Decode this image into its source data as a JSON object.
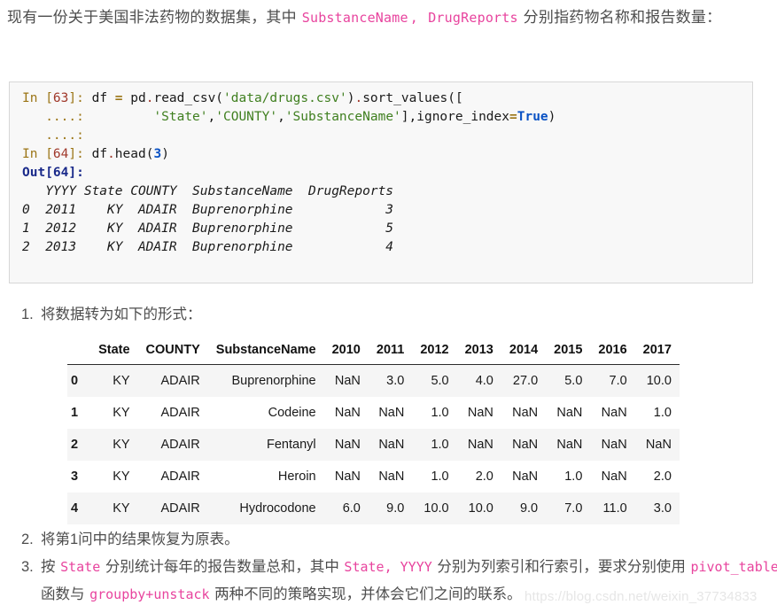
{
  "intro": {
    "part1": "现有一份关于美国非法药物的数据集，其中 ",
    "code1": "SubstanceName",
    "sep1": ", ",
    "code2": "DrugReports",
    "part2": " 分别指药物名称和报告数量："
  },
  "code_block": {
    "line1_prompt": "In [",
    "line1_num": "63",
    "line1_promptend": "]: ",
    "line1_a": "df ",
    "line1_eq": "=",
    "line1_b": " pd",
    "line1_dot1": ".",
    "line1_c": "read_csv(",
    "line1_str1": "'data/drugs.csv'",
    "line1_d": ")",
    "line1_dot2": ".",
    "line1_e": "sort_values([",
    "line2_dots": "   ....:         ",
    "line2_str1": "'State'",
    "line2_c1": ",",
    "line2_str2": "'COUNTY'",
    "line2_c2": ",",
    "line2_str3": "'SubstanceName'",
    "line2_rest": "],ignore_index",
    "line2_eq": "=",
    "line2_kw": "True",
    "line2_end": ")",
    "line3_dots": "   ....: ",
    "line4_prompt": "In [",
    "line4_num": "64",
    "line4_promptend": "]: ",
    "line4_a": "df",
    "line4_dot": ".",
    "line4_b": "head(",
    "line4_arg": "3",
    "line4_c": ")",
    "out_label": "Out[64]:",
    "out_header": "   YYYY State COUNTY  SubstanceName  DrugReports",
    "out_row0": "0  2011    KY  ADAIR  Buprenorphine            3",
    "out_row1": "1  2012    KY  ADAIR  Buprenorphine            5",
    "out_row2": "2  2013    KY  ADAIR  Buprenorphine            4"
  },
  "list": {
    "item1_marker": "1.",
    "item1_text": "将数据转为如下的形式：",
    "item2_marker": "2.",
    "item2_text": "将第1问中的结果恢复为原表。",
    "item3_marker": "3.",
    "item3_a": "按 ",
    "item3_code1": "State",
    "item3_b": " 分别统计每年的报告数量总和，其中 ",
    "item3_code2": "State, YYYY",
    "item3_c": " 分别为列索引和行索引，要求分别",
    "item3_d": "使用 ",
    "item3_code3": "pivot_table",
    "item3_e": " 函数与 ",
    "item3_code4": "groupby+unstack",
    "item3_f": " 两种不同的策略实现，并体会它们之间的联系。"
  },
  "table": {
    "columns": [
      "",
      "State",
      "COUNTY",
      "SubstanceName",
      "2010",
      "2011",
      "2012",
      "2013",
      "2014",
      "2015",
      "2016",
      "2017"
    ],
    "rows": [
      [
        "0",
        "KY",
        "ADAIR",
        "Buprenorphine",
        "NaN",
        "3.0",
        "5.0",
        "4.0",
        "27.0",
        "5.0",
        "7.0",
        "10.0"
      ],
      [
        "1",
        "KY",
        "ADAIR",
        "Codeine",
        "NaN",
        "NaN",
        "1.0",
        "NaN",
        "NaN",
        "NaN",
        "NaN",
        "1.0"
      ],
      [
        "2",
        "KY",
        "ADAIR",
        "Fentanyl",
        "NaN",
        "NaN",
        "1.0",
        "NaN",
        "NaN",
        "NaN",
        "NaN",
        "NaN"
      ],
      [
        "3",
        "KY",
        "ADAIR",
        "Heroin",
        "NaN",
        "NaN",
        "1.0",
        "2.0",
        "NaN",
        "1.0",
        "NaN",
        "2.0"
      ],
      [
        "4",
        "KY",
        "ADAIR",
        "Hydrocodone",
        "6.0",
        "9.0",
        "10.0",
        "10.0",
        "9.0",
        "7.0",
        "11.0",
        "3.0"
      ]
    ]
  },
  "watermark": {
    "text": "https://blog.csdn.net/weixin_37734833"
  },
  "colors": {
    "inline_code": "#e8449e",
    "body_text": "#4d4d4d",
    "code_bg": "#f8f8f8",
    "code_border": "#d7d7d7",
    "row_stripe": "#f5f5f5",
    "keyword": "#0a52c4",
    "string": "#3f7f1f",
    "prompt": "#9b7516",
    "out_label": "#1a2a8a"
  }
}
